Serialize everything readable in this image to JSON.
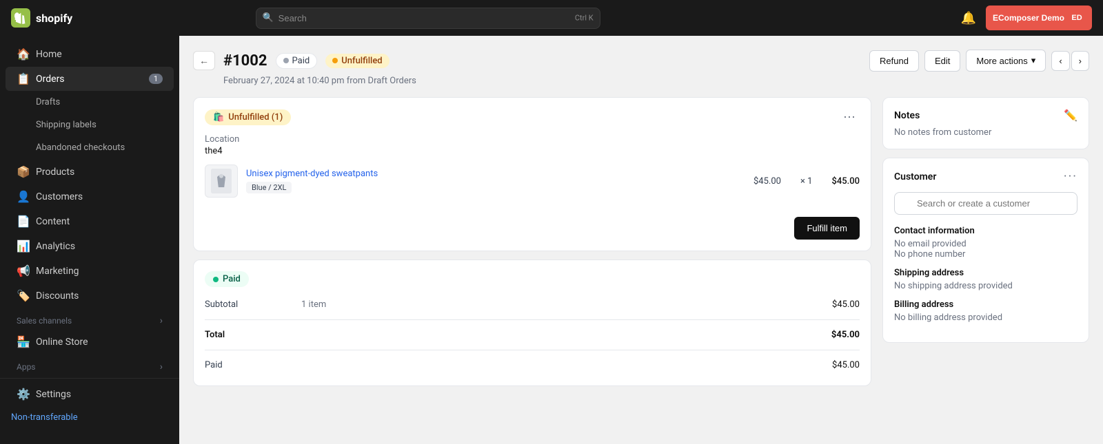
{
  "topbar": {
    "logo_text": "shopify",
    "search_placeholder": "Search",
    "search_shortcut": "Ctrl K",
    "account_name": "EComposer Demo",
    "account_initials": "ED"
  },
  "sidebar": {
    "items": [
      {
        "id": "home",
        "label": "Home",
        "icon": "🏠",
        "badge": null,
        "active": false
      },
      {
        "id": "orders",
        "label": "Orders",
        "icon": "📋",
        "badge": "1",
        "active": true
      },
      {
        "id": "products",
        "label": "Products",
        "icon": "📦",
        "badge": null,
        "active": false
      },
      {
        "id": "customers",
        "label": "Customers",
        "icon": "👤",
        "badge": null,
        "active": false
      },
      {
        "id": "content",
        "label": "Content",
        "icon": "📄",
        "badge": null,
        "active": false
      },
      {
        "id": "analytics",
        "label": "Analytics",
        "icon": "📊",
        "badge": null,
        "active": false
      },
      {
        "id": "marketing",
        "label": "Marketing",
        "icon": "📢",
        "badge": null,
        "active": false
      },
      {
        "id": "discounts",
        "label": "Discounts",
        "icon": "🏷️",
        "badge": null,
        "active": false
      }
    ],
    "sub_items": [
      {
        "label": "Drafts"
      },
      {
        "label": "Shipping labels"
      },
      {
        "label": "Abandoned checkouts"
      }
    ],
    "sales_channels_label": "Sales channels",
    "online_store_label": "Online Store",
    "apps_label": "Apps",
    "settings_label": "Settings",
    "non_transferable_label": "Non-transferable"
  },
  "order": {
    "number": "#1002",
    "paid_label": "Paid",
    "unfulfilled_label": "Unfulfilled",
    "date": "February 27, 2024 at 10:40 pm from Draft Orders",
    "refund_label": "Refund",
    "edit_label": "Edit",
    "more_actions_label": "More actions",
    "fulfillment_card": {
      "badge_label": "Unfulfilled (1)",
      "location_label": "Location",
      "location_value": "the4",
      "product_name": "Unisex pigment-dyed sweatpants",
      "product_variant": "Blue / 2XL",
      "product_price": "$45.00",
      "product_qty_symbol": "×",
      "product_qty": "1",
      "product_total": "$45.00",
      "fulfill_btn_label": "Fulfill item"
    },
    "payment_card": {
      "paid_label": "Paid",
      "subtotal_label": "Subtotal",
      "subtotal_sub": "1 item",
      "subtotal_amount": "$45.00",
      "total_label": "Total",
      "total_amount": "$45.00",
      "paid_row_label": "Paid",
      "paid_amount": "$45.00"
    }
  },
  "sidebar_right": {
    "notes": {
      "title": "Notes",
      "empty_text": "No notes from customer"
    },
    "customer": {
      "title": "Customer",
      "search_placeholder": "Search or create a customer",
      "contact_info_title": "Contact information",
      "no_email": "No email provided",
      "no_phone": "No phone number",
      "shipping_title": "Shipping address",
      "no_shipping": "No shipping address provided",
      "billing_title": "Billing address",
      "no_billing": "No billing address provided"
    }
  }
}
